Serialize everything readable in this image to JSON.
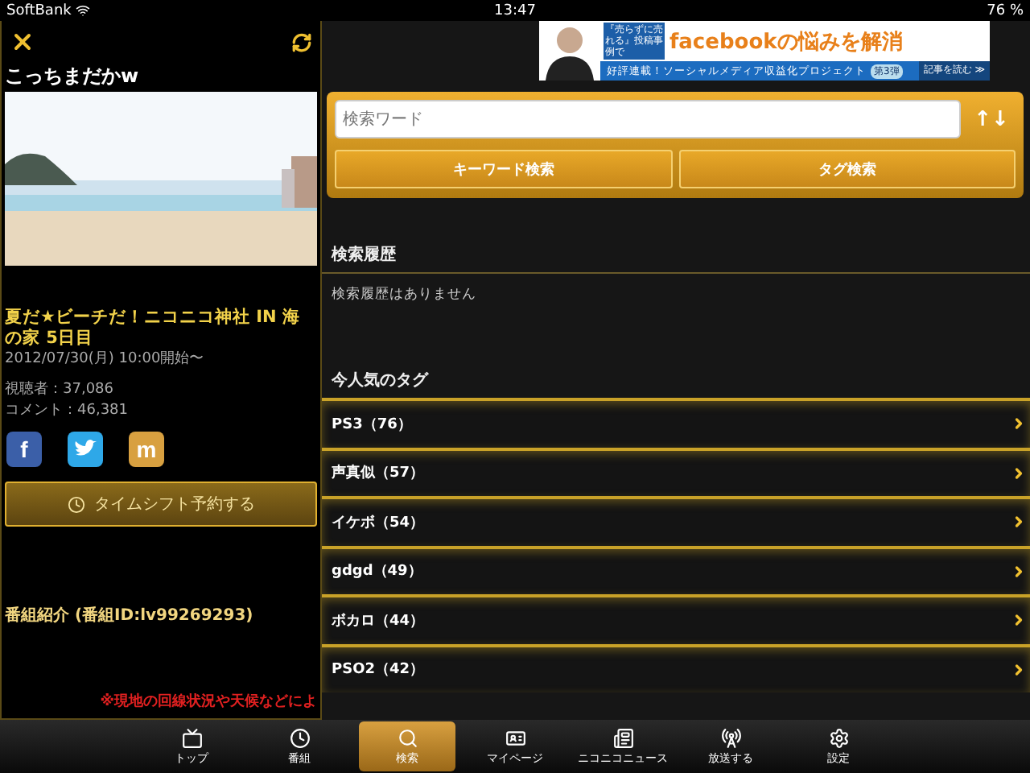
{
  "status_bar": {
    "carrier": "SoftBank",
    "time": "13:47",
    "battery": "76 %"
  },
  "program": {
    "header": "こっちまだかw",
    "title": "夏だ★ビーチだ！ニコニコ神社 IN 海の家 5日目",
    "date": "2012/07/30(月) 10:00開始〜",
    "viewers": "視聴者：37,086",
    "comments": "コメント：46,381",
    "share": [
      {
        "kind": "facebook",
        "label": "f"
      },
      {
        "kind": "twitter"
      },
      {
        "kind": "mixi",
        "label": "m"
      }
    ],
    "timeshift_button": "タイムシフト予約する",
    "description_heading": "番組紹介 (番組ID:lv99269293)",
    "notice": "※現地の回線状況や天候などによ"
  },
  "ad": {
    "line_1": "『売らずに売れる』投稿事例で",
    "headline": "facebookの悩みを解消",
    "subline": "好評連載！ソーシャルメディア収益化プロジェクト",
    "badge": "第3弾",
    "link": "記事を読む ≫"
  },
  "search": {
    "placeholder": "検索ワード",
    "sort_icon": "↑↓",
    "buttons": [
      "キーワード検索",
      "タグ検索"
    ]
  },
  "history": {
    "heading": "検索履歴",
    "empty": "検索履歴はありません"
  },
  "popular_tags": {
    "heading": "今人気のタグ",
    "items": [
      {
        "label": "PS3（76）"
      },
      {
        "label": "声真似（57）"
      },
      {
        "label": "イケボ（54）"
      },
      {
        "label": "gdgd（49）"
      },
      {
        "label": "ボカロ（44）"
      },
      {
        "label": "PSO2（42）"
      }
    ]
  },
  "tab_bar": [
    {
      "kind": "tv",
      "label": "トップ",
      "selected": false
    },
    {
      "kind": "clock",
      "label": "番組",
      "selected": false
    },
    {
      "kind": "search",
      "label": "検索",
      "selected": true
    },
    {
      "kind": "card",
      "label": "マイページ",
      "selected": false
    },
    {
      "kind": "news",
      "label": "ニコニコニュース",
      "selected": false
    },
    {
      "kind": "antenna",
      "label": "放送する",
      "selected": false
    },
    {
      "kind": "gear",
      "label": "設定",
      "selected": false
    }
  ]
}
